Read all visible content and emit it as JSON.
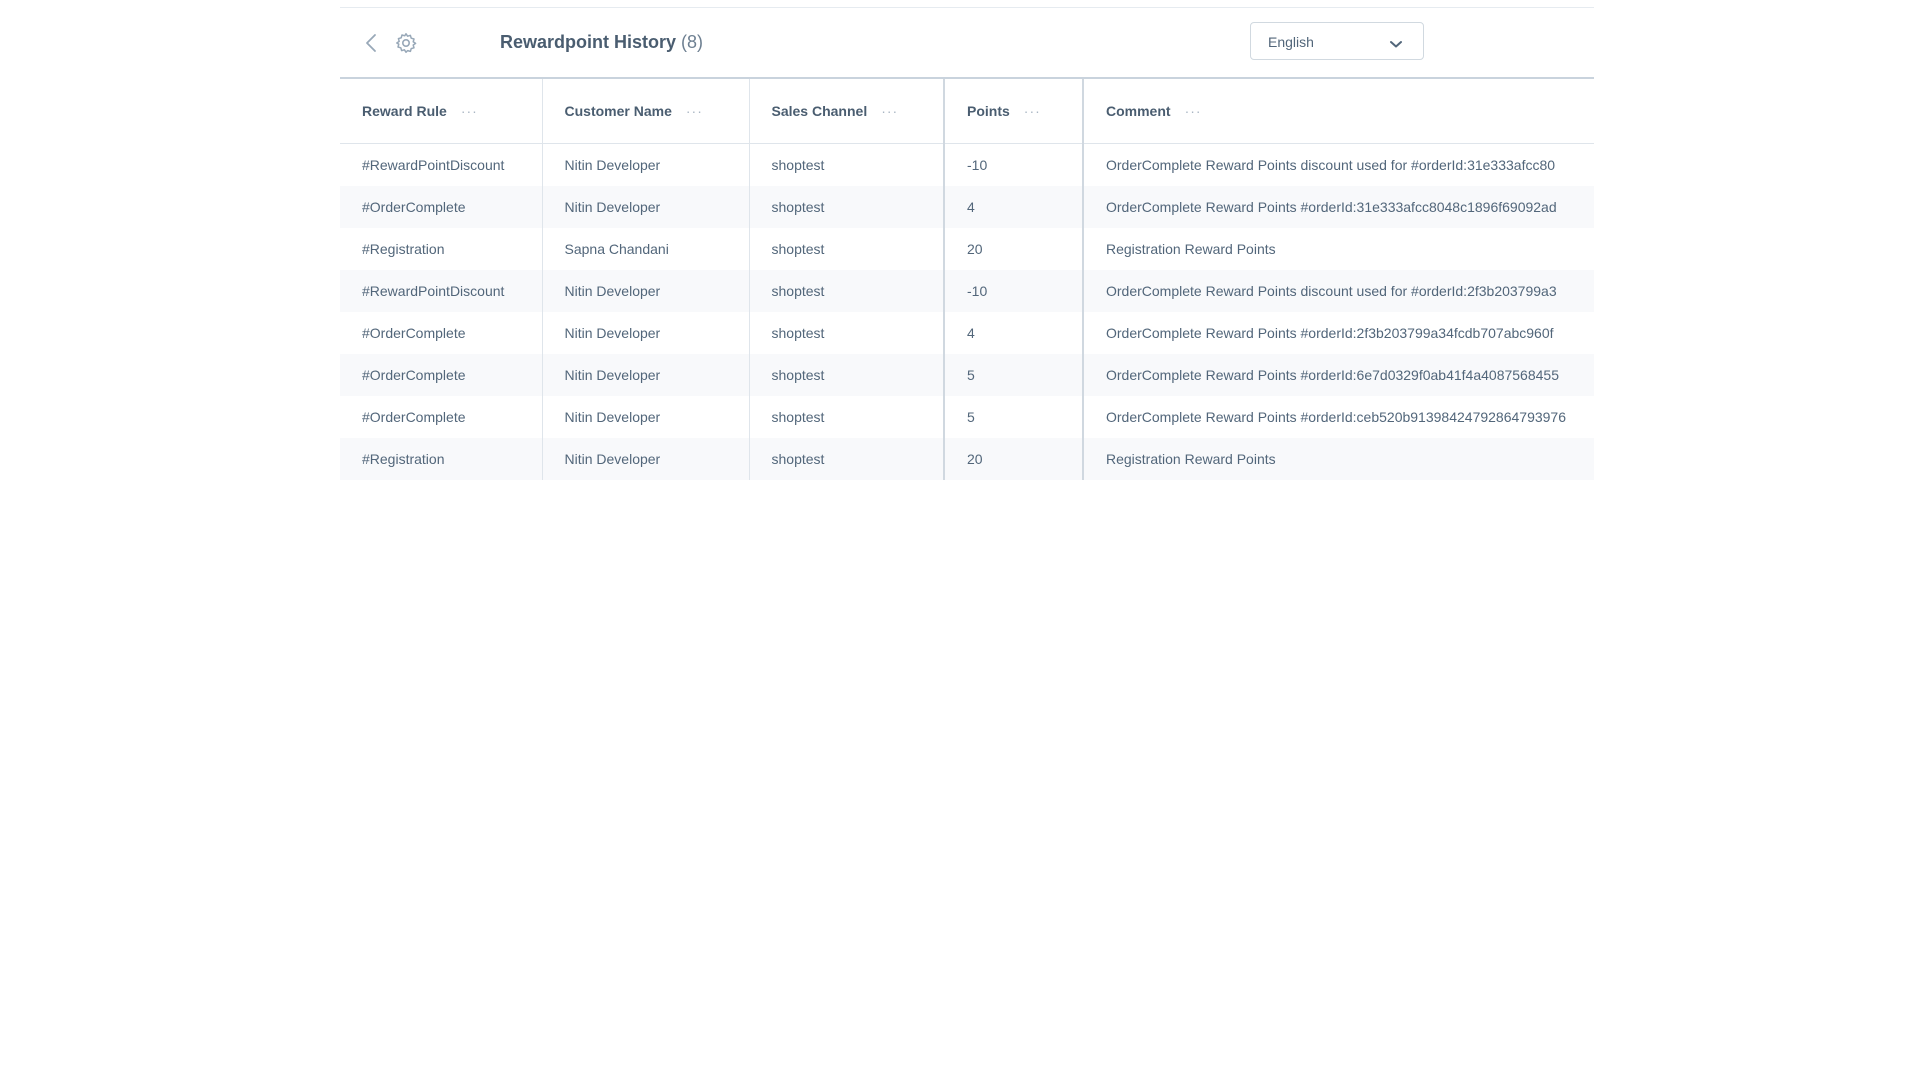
{
  "header": {
    "title": "Rewardpoint History",
    "count": "(8)",
    "language": "English",
    "icons": {
      "back": "chevron-left-icon",
      "settings": "gear-icon",
      "dropdown": "chevron-down-icon"
    }
  },
  "table": {
    "columns": [
      {
        "label": "Reward Rule",
        "menu": "···"
      },
      {
        "label": "Customer Name",
        "menu": "···"
      },
      {
        "label": "Sales Channel",
        "menu": "···"
      },
      {
        "label": "Points",
        "menu": "···"
      },
      {
        "label": "Comment",
        "menu": "···"
      }
    ],
    "rows": [
      [
        "#RewardPointDiscount",
        "Nitin Developer",
        "shoptest",
        "-10",
        "OrderComplete Reward Points discount used for #orderId:31e333afcc80"
      ],
      [
        "#OrderComplete",
        "Nitin Developer",
        "shoptest",
        "4",
        "OrderComplete Reward Points #orderId:31e333afcc8048c1896f69092ad"
      ],
      [
        "#Registration",
        "Sapna Chandani",
        "shoptest",
        "20",
        "Registration Reward Points"
      ],
      [
        "#RewardPointDiscount",
        "Nitin Developer",
        "shoptest",
        "-10",
        "OrderComplete Reward Points discount used for #orderId:2f3b203799a3"
      ],
      [
        "#OrderComplete",
        "Nitin Developer",
        "shoptest",
        "4",
        "OrderComplete Reward Points #orderId:2f3b203799a34fcdb707abc960f"
      ],
      [
        "#OrderComplete",
        "Nitin Developer",
        "shoptest",
        "5",
        "OrderComplete Reward Points #orderId:6e7d0329f0ab41f4a4087568455"
      ],
      [
        "#OrderComplete",
        "Nitin Developer",
        "shoptest",
        "5",
        "OrderComplete Reward Points #orderId:ceb520b91398424792864793976"
      ],
      [
        "#Registration",
        "Nitin Developer",
        "shoptest",
        "20",
        "Registration Reward Points"
      ]
    ]
  },
  "colors": {
    "text": "#52667a",
    "heading": "#4a5d70",
    "row_alt": "#f8f9fb",
    "border": "#dfe5eb"
  }
}
